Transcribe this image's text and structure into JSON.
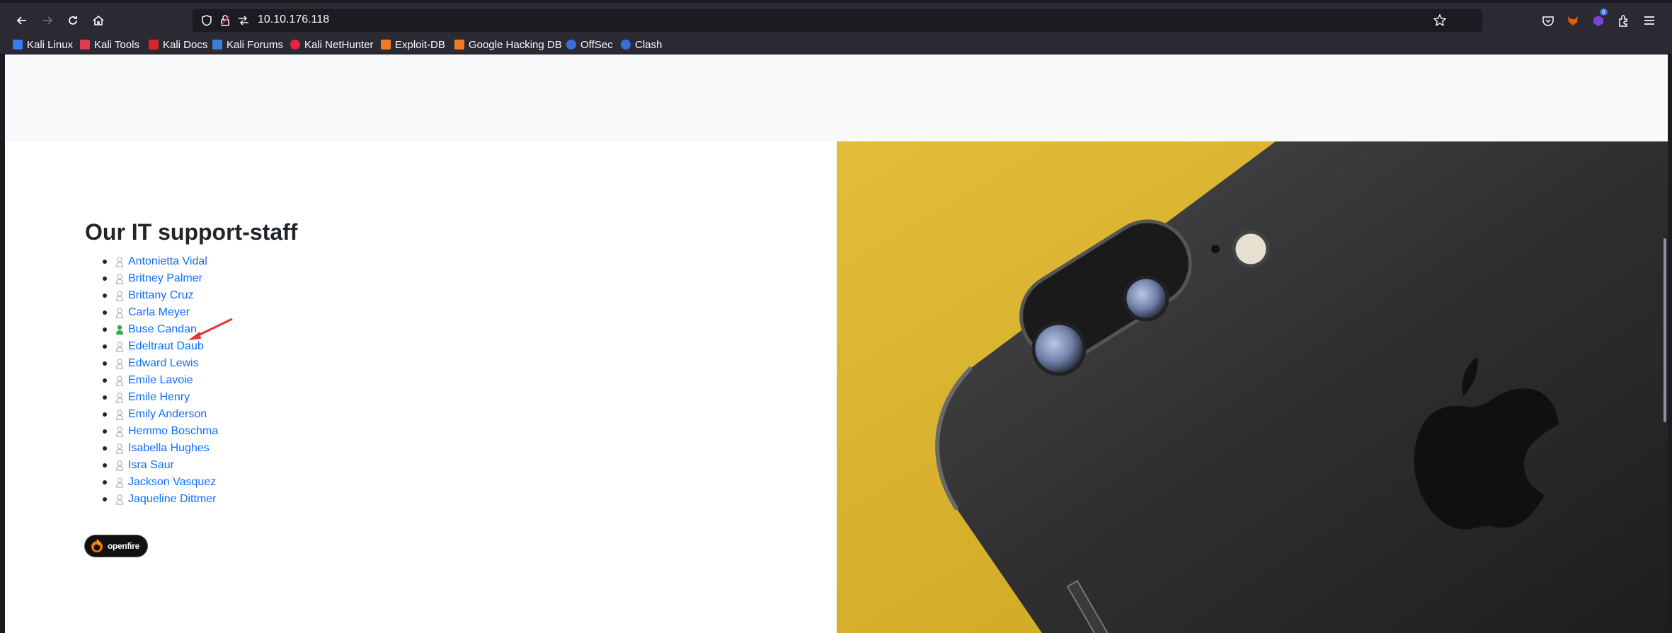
{
  "browser": {
    "url": "10.10.176.118",
    "bookmarks": [
      {
        "label": "Kali Linux",
        "icon": "kali-dragon-icon",
        "color": "#367bf0"
      },
      {
        "label": "Kali Tools",
        "icon": "kali-tools-icon",
        "color": "#e33b4d"
      },
      {
        "label": "Kali Docs",
        "icon": "kali-docs-icon",
        "color": "#d8252c"
      },
      {
        "label": "Kali Forums",
        "icon": "kali-forums-icon",
        "color": "#3a7fd5"
      },
      {
        "label": "Kali NetHunter",
        "icon": "nethunter-icon",
        "color": "#e8233c"
      },
      {
        "label": "Exploit-DB",
        "icon": "exploit-db-icon",
        "color": "#f27b22"
      },
      {
        "label": "Google Hacking DB",
        "icon": "ghdb-icon",
        "color": "#f27b22"
      },
      {
        "label": "OffSec",
        "icon": "offsec-icon",
        "color": "#3a6fd8"
      },
      {
        "label": "Clash",
        "icon": "clash-icon",
        "color": "#3a6fd8"
      }
    ],
    "extension_badge": "6"
  },
  "page": {
    "section_title": "Our IT support-staff",
    "staff": [
      {
        "name": "Antonietta Vidal",
        "online": false
      },
      {
        "name": "Britney Palmer",
        "online": false
      },
      {
        "name": "Brittany Cruz",
        "online": false
      },
      {
        "name": "Carla Meyer",
        "online": false
      },
      {
        "name": "Buse Candan",
        "online": true
      },
      {
        "name": "Edeltraut Daub",
        "online": false
      },
      {
        "name": "Edward Lewis",
        "online": false
      },
      {
        "name": "Emile Lavoie",
        "online": false
      },
      {
        "name": "Emile Henry",
        "online": false
      },
      {
        "name": "Emily Anderson",
        "online": false
      },
      {
        "name": "Hemmo Boschma",
        "online": false
      },
      {
        "name": "Isabella Hughes",
        "online": false
      },
      {
        "name": "Isra Saur",
        "online": false
      },
      {
        "name": "Jackson Vasquez",
        "online": false
      },
      {
        "name": "Jaqueline Dittmer",
        "online": false
      }
    ],
    "badge_label": "openfire",
    "colors": {
      "link": "#0d6efd",
      "online": "#2fa84f",
      "offline": "#b0b4b8",
      "annotation": "#e8333a"
    }
  }
}
